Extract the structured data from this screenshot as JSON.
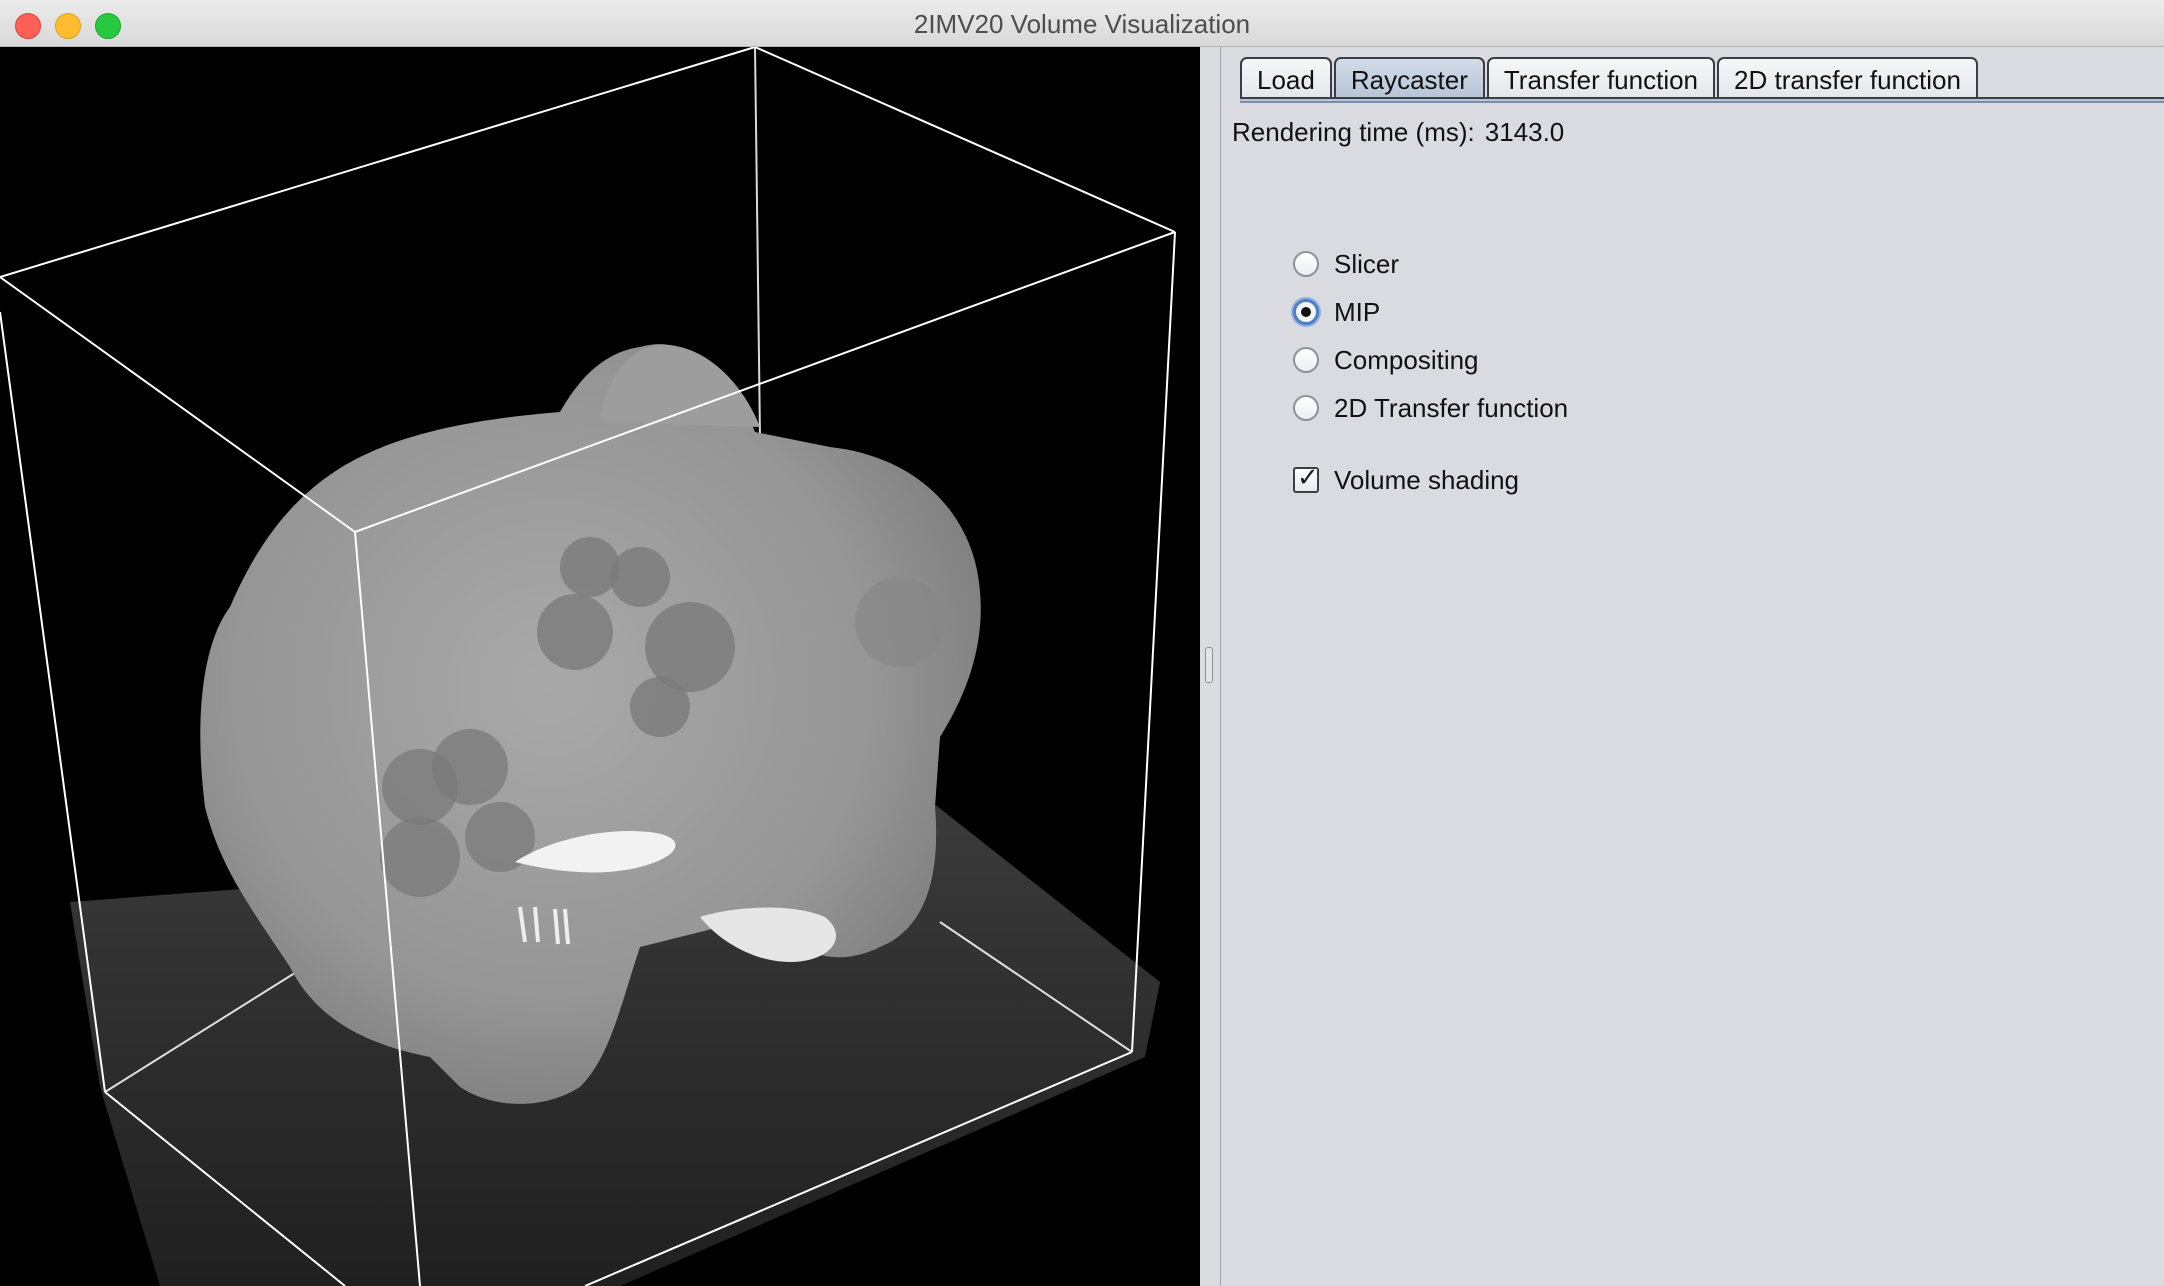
{
  "window": {
    "title": "2IMV20 Volume Visualization"
  },
  "tabs": [
    {
      "label": "Load",
      "active": false
    },
    {
      "label": "Raycaster",
      "active": true
    },
    {
      "label": "Transfer function",
      "active": false
    },
    {
      "label": "2D transfer function",
      "active": false
    }
  ],
  "raycaster": {
    "rendering_time_label": "Rendering time (ms):",
    "rendering_time_value": "3143.0",
    "modes": [
      {
        "label": "Slicer",
        "checked": false
      },
      {
        "label": "MIP",
        "checked": true
      },
      {
        "label": "Compositing",
        "checked": false
      },
      {
        "label": "2D Transfer function",
        "checked": false
      }
    ],
    "volume_shading": {
      "label": "Volume shading",
      "checked": true,
      "mark": "✓"
    }
  },
  "colors": {
    "panel_background": "#d9dbe1",
    "viewport_background": "#000000",
    "bounding_box": "#ffffff",
    "active_tab": "#b6c4d6",
    "radio_selected_ring": "#4d7fc6"
  },
  "icons": {
    "close": "close-icon",
    "minimize": "minimize-icon",
    "maximize": "maximize-icon",
    "split_handle": "grip-icon"
  }
}
